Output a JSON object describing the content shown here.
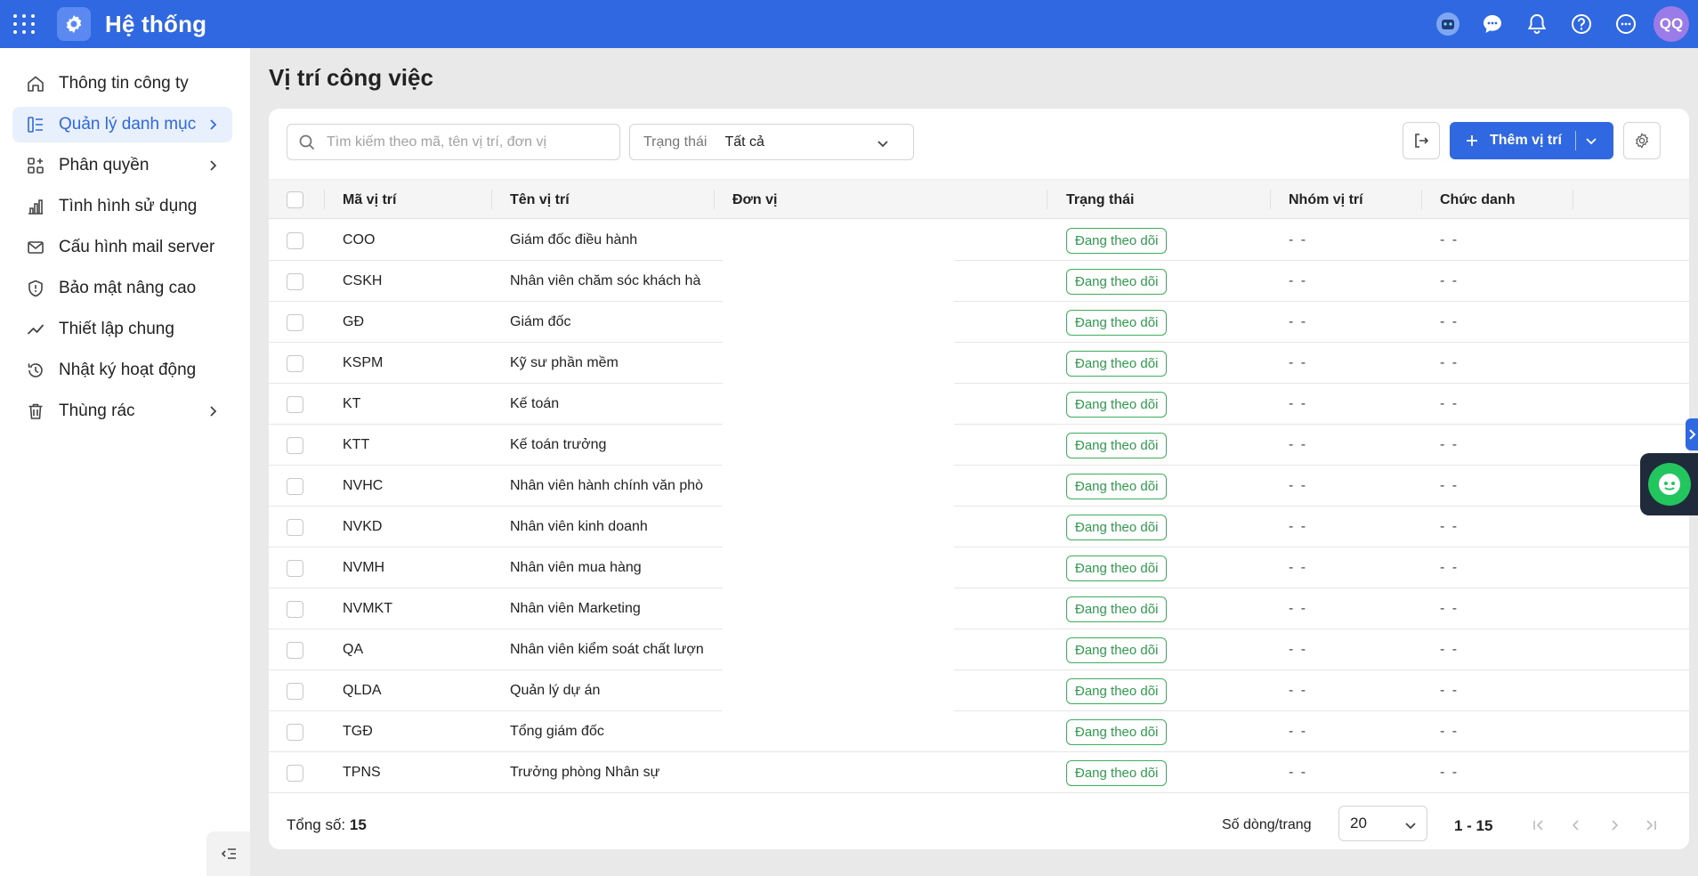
{
  "app": {
    "title": "Hệ thống",
    "avatar_initials": "QQ"
  },
  "colors": {
    "brand": "#2f68e0",
    "status_green": "#2e9b4d"
  },
  "sidebar": {
    "items": [
      {
        "label": "Thông tin công ty",
        "icon": "home-icon",
        "has_children": false,
        "active": false
      },
      {
        "label": "Quản lý danh mục",
        "icon": "category-icon",
        "has_children": true,
        "active": true
      },
      {
        "label": "Phân quyền",
        "icon": "grid-plus-icon",
        "has_children": true,
        "active": false
      },
      {
        "label": "Tình hình sử dụng",
        "icon": "bar-chart-icon",
        "has_children": false,
        "active": false
      },
      {
        "label": "Cấu hình mail server",
        "icon": "mail-icon",
        "has_children": false,
        "active": false
      },
      {
        "label": "Bảo mật nâng cao",
        "icon": "shield-icon",
        "has_children": false,
        "active": false
      },
      {
        "label": "Thiết lập chung",
        "icon": "trend-icon",
        "has_children": false,
        "active": false
      },
      {
        "label": "Nhật ký hoạt động",
        "icon": "history-icon",
        "has_children": false,
        "active": false
      },
      {
        "label": "Thùng rác",
        "icon": "trash-icon",
        "has_children": true,
        "active": false
      }
    ]
  },
  "page": {
    "title": "Vị trí công việc"
  },
  "toolbar": {
    "search_placeholder": "Tìm kiếm theo mã, tên vị trí, đơn vị",
    "status_label": "Trạng thái",
    "status_value": "Tất cả",
    "add_label": "Thêm vị trí"
  },
  "table": {
    "columns": [
      "Mã vị trí",
      "Tên vị trí",
      "Đơn vị",
      "Trạng thái",
      "Nhóm vị trí",
      "Chức danh"
    ],
    "rows": [
      {
        "code": "COO",
        "name": "Giám đốc điều hành",
        "unit": "",
        "status": "Đang theo dõi",
        "group": "- -",
        "title": "- -"
      },
      {
        "code": "CSKH",
        "name": "Nhân viên chăm sóc khách hà",
        "unit": "",
        "status": "Đang theo dõi",
        "group": "- -",
        "title": "- -"
      },
      {
        "code": "GĐ",
        "name": "Giám đốc",
        "unit": "",
        "status": "Đang theo dõi",
        "group": "- -",
        "title": "- -"
      },
      {
        "code": "KSPM",
        "name": "Kỹ sư phần mềm",
        "unit": "",
        "status": "Đang theo dõi",
        "group": "- -",
        "title": "- -"
      },
      {
        "code": "KT",
        "name": "Kế toán",
        "unit": "",
        "status": "Đang theo dõi",
        "group": "- -",
        "title": "- -"
      },
      {
        "code": "KTT",
        "name": "Kế toán trưởng",
        "unit": "",
        "status": "Đang theo dõi",
        "group": "- -",
        "title": "- -"
      },
      {
        "code": "NVHC",
        "name": "Nhân viên hành chính văn phò",
        "unit": "",
        "status": "Đang theo dõi",
        "group": "- -",
        "title": "- -"
      },
      {
        "code": "NVKD",
        "name": "Nhân viên kinh doanh",
        "unit": "",
        "status": "Đang theo dõi",
        "group": "- -",
        "title": "- -"
      },
      {
        "code": "NVMH",
        "name": "Nhân viên mua hàng",
        "unit": "",
        "status": "Đang theo dõi",
        "group": "- -",
        "title": "- -"
      },
      {
        "code": "NVMKT",
        "name": "Nhân viên Marketing",
        "unit": "",
        "status": "Đang theo dõi",
        "group": "- -",
        "title": "- -"
      },
      {
        "code": "QA",
        "name": "Nhân viên kiểm soát chất lượn",
        "unit": "",
        "status": "Đang theo dõi",
        "group": "- -",
        "title": "- -"
      },
      {
        "code": "QLDA",
        "name": "Quản lý dự án",
        "unit": "",
        "status": "Đang theo dõi",
        "group": "- -",
        "title": "- -"
      },
      {
        "code": "TGĐ",
        "name": "Tổng giám đốc",
        "unit": "",
        "status": "Đang theo dõi",
        "group": "- -",
        "title": "- -"
      },
      {
        "code": "TPNS",
        "name": "Trưởng phòng Nhân sự",
        "unit": "",
        "status": "Đang theo dõi",
        "group": "- -",
        "title": "- -"
      }
    ]
  },
  "footer": {
    "total_label": "Tổng số:",
    "total_value": "15",
    "rows_per_page_label": "Số dòng/trang",
    "rows_per_page_value": "20",
    "range": "1 - 15"
  }
}
